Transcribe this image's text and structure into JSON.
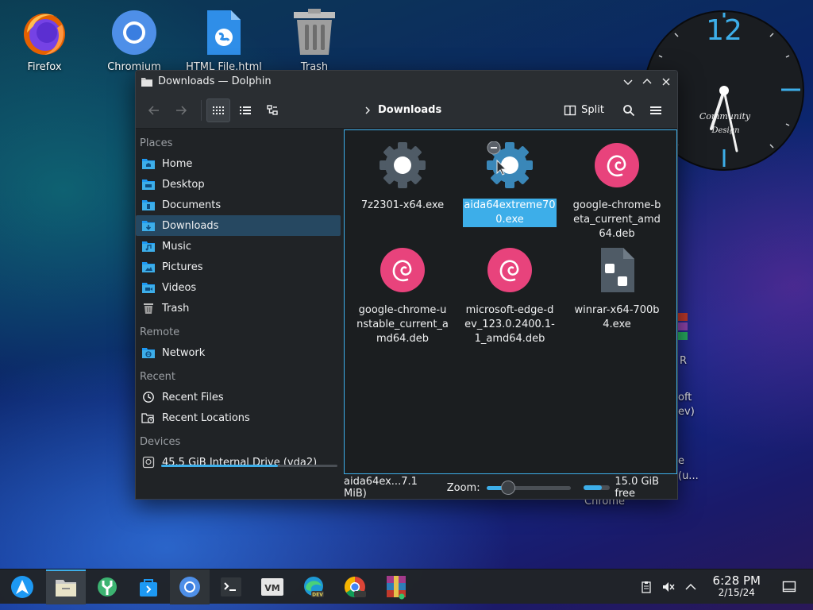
{
  "desktop": {
    "icons": [
      {
        "label": "Firefox"
      },
      {
        "label": "Chromium"
      },
      {
        "label": "HTML File.html"
      },
      {
        "label": "Trash"
      }
    ],
    "partial_labels": [
      "R",
      "oft",
      "ev)",
      "e",
      "(u...",
      "Chrome"
    ]
  },
  "clock_widget": {
    "hour_marker": "12",
    "brand_line1": "Community",
    "brand_line2": "Design"
  },
  "window": {
    "title": "Downloads — Dolphin",
    "toolbar": {
      "breadcrumb": "Downloads",
      "split_label": "Split"
    },
    "sidebar": {
      "sections": [
        {
          "title": "Places",
          "items": [
            {
              "label": "Home",
              "icon": "home-folder-icon"
            },
            {
              "label": "Desktop",
              "icon": "desktop-folder-icon"
            },
            {
              "label": "Documents",
              "icon": "documents-folder-icon"
            },
            {
              "label": "Downloads",
              "icon": "downloads-folder-icon",
              "selected": true
            },
            {
              "label": "Music",
              "icon": "music-folder-icon"
            },
            {
              "label": "Pictures",
              "icon": "pictures-folder-icon"
            },
            {
              "label": "Videos",
              "icon": "videos-folder-icon"
            },
            {
              "label": "Trash",
              "icon": "trash-icon"
            }
          ]
        },
        {
          "title": "Remote",
          "items": [
            {
              "label": "Network",
              "icon": "network-folder-icon"
            }
          ]
        },
        {
          "title": "Recent",
          "items": [
            {
              "label": "Recent Files",
              "icon": "clock-icon"
            },
            {
              "label": "Recent Locations",
              "icon": "folder-clock-icon"
            }
          ]
        },
        {
          "title": "Devices",
          "items": [
            {
              "label": "45.5 GiB Internal Drive (vda2)",
              "icon": "drive-icon",
              "usage_fraction": 0.66
            }
          ]
        }
      ]
    },
    "files": [
      {
        "name": "7z2301-x64.exe",
        "icon": "gear-icon"
      },
      {
        "name": "aida64extreme700.exe",
        "icon": "gear-icon",
        "selected": true
      },
      {
        "name": "google-chrome-beta_current_amd64.deb",
        "icon": "debian-icon"
      },
      {
        "name": "google-chrome-unstable_current_amd64.deb",
        "icon": "debian-icon"
      },
      {
        "name": "microsoft-edge-dev_123.0.2400.1-1_amd64.deb",
        "icon": "debian-icon"
      },
      {
        "name": "winrar-x64-700b4.exe",
        "icon": "generic-file-icon"
      }
    ],
    "status": {
      "selection": "aida64ex...7.1 MiB)",
      "zoom_label": "Zoom:",
      "zoom_fraction": 0.26,
      "free_space": "15.0 GiB free",
      "used_fraction": 0.7
    }
  },
  "taskbar": {
    "tasks": [
      "application-launcher",
      "dolphin",
      "system-settings",
      "discover",
      "chromium",
      "konsole",
      "virt-manager",
      "edge-dev",
      "chrome-dev",
      "winrar"
    ],
    "clock_time": "6:28 PM",
    "clock_date": "2/15/24"
  },
  "colors": {
    "accent": "#3daee9",
    "window_bg": "#202326",
    "selection": "#264861",
    "debian": "#e8437c"
  }
}
